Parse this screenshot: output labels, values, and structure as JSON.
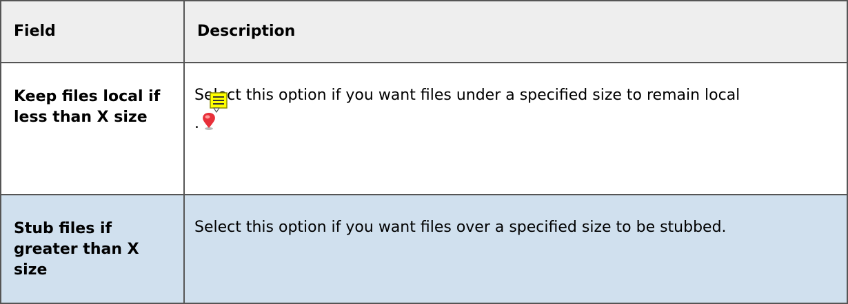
{
  "table": {
    "headers": {
      "field": "Field",
      "description": "Description"
    },
    "rows": [
      {
        "field": "Keep files local if less than X size",
        "description": "Select this option if you want files under a specified size to remain local",
        "trailing": "."
      },
      {
        "field": "Stub files if greater than X size",
        "description": "Select this option if you want files over a specified size to be stubbed."
      }
    ]
  },
  "icons": {
    "note": "sticky-note-icon",
    "pin": "location-pin-icon"
  },
  "colors": {
    "header_bg": "#eeeeee",
    "highlight_row_bg": "#d0e0ee",
    "border": "#555555",
    "note_yellow": "#ffff00",
    "pin_red": "#e8303a"
  }
}
